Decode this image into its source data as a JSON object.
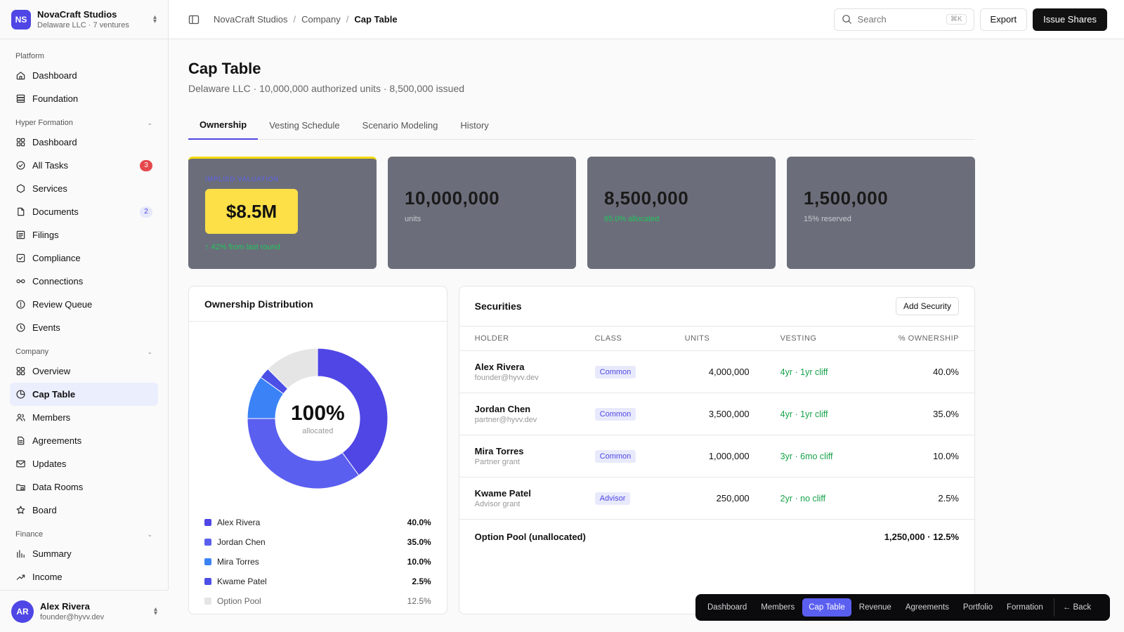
{
  "org": {
    "initials": "NS",
    "name": "NovaCraft Studios",
    "sub": "Delaware LLC · 7 ventures"
  },
  "sidebar": {
    "sections": [
      {
        "title": "Platform",
        "items": [
          {
            "label": "Dashboard",
            "icon": "home-icon"
          },
          {
            "label": "Foundation",
            "icon": "database-icon"
          }
        ]
      },
      {
        "title": "Hyper Formation",
        "items": [
          {
            "label": "Dashboard",
            "icon": "grid-icon"
          },
          {
            "label": "All Tasks",
            "icon": "check-circle-icon",
            "badge": "3"
          },
          {
            "label": "Services",
            "icon": "hexagon-icon"
          },
          {
            "label": "Documents",
            "icon": "file-icon",
            "badge": "2"
          },
          {
            "label": "Filings",
            "icon": "list-icon"
          },
          {
            "label": "Compliance",
            "icon": "check-square-icon"
          },
          {
            "label": "Connections",
            "icon": "link-icon"
          },
          {
            "label": "Review Queue",
            "icon": "alert-circle-icon"
          },
          {
            "label": "Events",
            "icon": "clock-icon"
          }
        ]
      },
      {
        "title": "Company",
        "items": [
          {
            "label": "Overview",
            "icon": "grid-icon"
          },
          {
            "label": "Cap Table",
            "icon": "pie-chart-icon",
            "active": true
          },
          {
            "label": "Members",
            "icon": "users-icon"
          },
          {
            "label": "Agreements",
            "icon": "file-text-icon"
          },
          {
            "label": "Updates",
            "icon": "mail-icon"
          },
          {
            "label": "Data Rooms",
            "icon": "folder-lock-icon"
          },
          {
            "label": "Board",
            "icon": "star-icon"
          }
        ]
      },
      {
        "title": "Finance",
        "items": [
          {
            "label": "Summary",
            "icon": "bar-chart-icon"
          },
          {
            "label": "Income",
            "icon": "trending-up-icon"
          }
        ]
      }
    ]
  },
  "user": {
    "initials": "AR",
    "name": "Alex Rivera",
    "email": "founder@hyvv.dev"
  },
  "topbar": {
    "breadcrumb": [
      "NovaCraft Studios",
      "Company",
      "Cap Table"
    ],
    "search_placeholder": "Search",
    "search_shortcut": "⌘K",
    "export_label": "Export",
    "issue_label": "Issue Shares"
  },
  "page": {
    "title": "Cap Table",
    "subtitle": "Delaware LLC · 10,000,000 authorized units · 8,500,000 issued",
    "tabs": [
      "Ownership",
      "Vesting Schedule",
      "Scenario Modeling",
      "History"
    ]
  },
  "stats": {
    "valuation_label": "IMPLIED VALUATION",
    "valuation": "$8.5M",
    "valuation_delta": "↑ 42% from last round",
    "authorized": "10,000,000",
    "authorized_sub": "units",
    "issued": "8,500,000",
    "issued_sub": "85.0% allocated",
    "reserved": "1,500,000",
    "reserved_sub": "15% reserved"
  },
  "distribution": {
    "title": "Ownership Distribution",
    "center_value": "100%",
    "center_label": "allocated",
    "legend": [
      {
        "name": "Alex Rivera",
        "pct": "40.0%",
        "value": 40.0,
        "color": "#4f46e5"
      },
      {
        "name": "Jordan Chen",
        "pct": "35.0%",
        "value": 35.0,
        "color": "#5b5ff0"
      },
      {
        "name": "Mira Torres",
        "pct": "10.0%",
        "value": 10.0,
        "color": "#3b82f6"
      },
      {
        "name": "Kwame Patel",
        "pct": "2.5%",
        "value": 2.5,
        "color": "#4c4fe6"
      },
      {
        "name": "Option Pool",
        "pct": "12.5%",
        "value": 12.5,
        "color": "#e5e5e5"
      }
    ]
  },
  "securities": {
    "title": "Securities",
    "add_label": "Add Security",
    "columns": [
      "HOLDER",
      "CLASS",
      "UNITS",
      "VESTING",
      "% OWNERSHIP"
    ],
    "rows": [
      {
        "name": "Alex Rivera",
        "sub": "founder@hyvv.dev",
        "class": "Common",
        "units": "4,000,000",
        "vesting": "4yr · 1yr cliff",
        "ownership": "40.0%"
      },
      {
        "name": "Jordan Chen",
        "sub": "partner@hyvv.dev",
        "class": "Common",
        "units": "3,500,000",
        "vesting": "4yr · 1yr cliff",
        "ownership": "35.0%"
      },
      {
        "name": "Mira Torres",
        "sub": "Partner grant",
        "class": "Common",
        "units": "1,000,000",
        "vesting": "3yr · 6mo cliff",
        "ownership": "10.0%"
      },
      {
        "name": "Kwame Patel",
        "sub": "Advisor grant",
        "class": "Advisor",
        "units": "250,000",
        "vesting": "2yr · no cliff",
        "ownership": "2.5%"
      }
    ],
    "pool_label": "Option Pool (unallocated)",
    "pool_value": "1,250,000 · 12.5%"
  },
  "devnav": {
    "items": [
      "Dashboard",
      "Members",
      "Cap Table",
      "Revenue",
      "Agreements",
      "Portfolio",
      "Formation"
    ],
    "active": "Cap Table",
    "back_label": "← Back"
  }
}
